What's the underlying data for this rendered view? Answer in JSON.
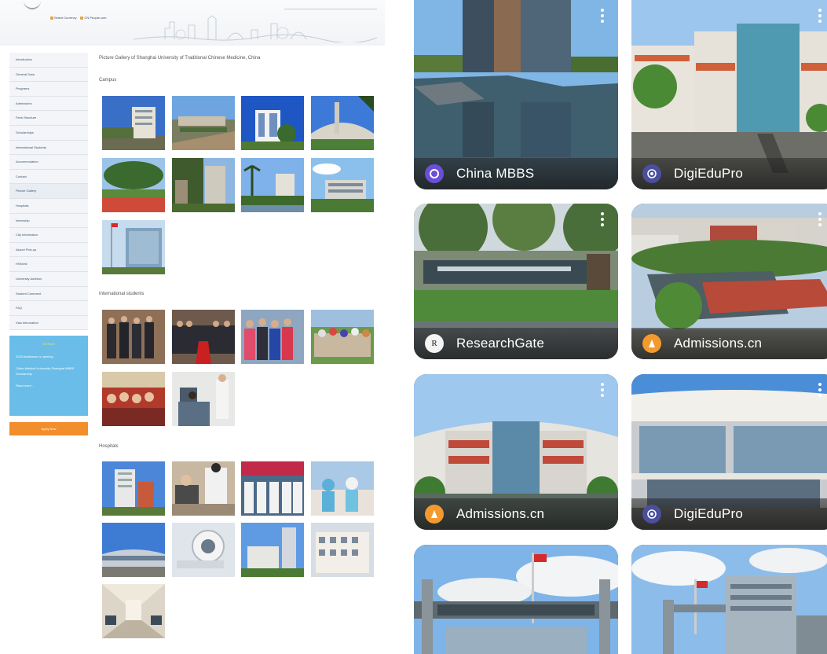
{
  "webpage": {
    "banner_links": [
      "Select Currency",
      "CN People.com"
    ],
    "nav": [
      "Introduction",
      "General Data",
      "Programs",
      "Admissions",
      "Fees Structure",
      "Scholarships",
      "International Students",
      "Accommodation",
      "Contact",
      "Picture Gallery",
      "Hospitals",
      "Internship",
      "City Information",
      "Airport Pick-up",
      "HSKtest",
      "University Address",
      "Student Comment",
      "FAQ",
      "Visa Information"
    ],
    "notice": {
      "title": "NOTICE",
      "lines": [
        "2023 Admission is opening",
        "China Medical University Shanghai MBBS Scholarship",
        "Read more..."
      ]
    },
    "apply_label": "Apply Now",
    "heading": "Picture Gallery of Shanghai University of Traditional Chinese Medicine, China",
    "sections": {
      "campus": "Campus",
      "students": "International students",
      "hospitals": "Hospitals"
    }
  },
  "cards": [
    {
      "source": "China MBBS",
      "icon": "china-mbbs-icon",
      "color": "#6b4fd8"
    },
    {
      "source": "DigiEduPro",
      "icon": "digiedupro-icon",
      "color": "#4b4f9c"
    },
    {
      "source": "ResearchGate",
      "icon": "researchgate-icon",
      "color": "#f4f4f4"
    },
    {
      "source": "Admissions.cn",
      "icon": "admissions-cn-icon",
      "color": "#f39a2e"
    },
    {
      "source": "Admissions.cn",
      "icon": "admissions-cn-icon",
      "color": "#f39a2e"
    },
    {
      "source": "DigiEduPro",
      "icon": "digiedupro-icon",
      "color": "#4b4f9c"
    }
  ]
}
